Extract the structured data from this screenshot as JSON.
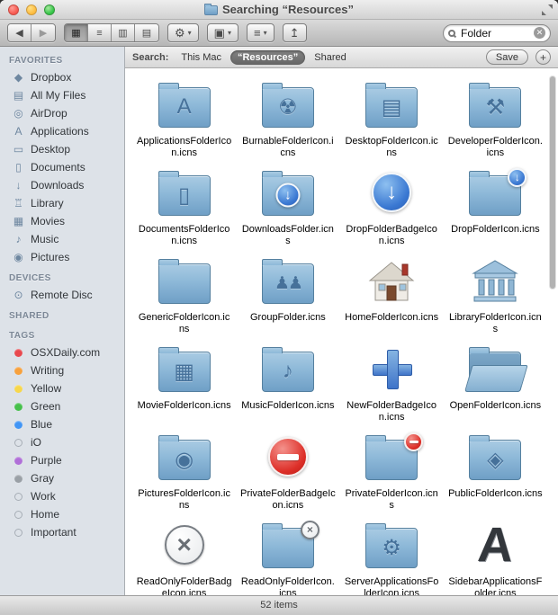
{
  "window": {
    "title": "Searching “Resources”",
    "status": "52 items"
  },
  "toolbar": {
    "back_icon": "◀",
    "forward_icon": "▶",
    "dropdown_arrow": "▾",
    "view_modes": [
      {
        "name": "icon-view",
        "glyph": "▦",
        "selected": true
      },
      {
        "name": "list-view",
        "glyph": "≡",
        "selected": false
      },
      {
        "name": "column-view",
        "glyph": "▥",
        "selected": false
      },
      {
        "name": "coverflow-view",
        "glyph": "▤",
        "selected": false
      }
    ],
    "menus": [
      {
        "name": "action-menu",
        "icon": "gear-icon",
        "glyph": "⚙"
      },
      {
        "name": "arrange-menu",
        "icon": "arrange-icon",
        "glyph": "▣"
      },
      {
        "name": "view-options-menu",
        "icon": "list-lines-icon",
        "glyph": "≡"
      }
    ],
    "share_glyph": "↥",
    "search": {
      "value": "Folder",
      "clear_icon": "✕"
    }
  },
  "scopebar": {
    "label": "Search:",
    "scopes": [
      {
        "label": "This Mac",
        "selected": false
      },
      {
        "label": "“Resources”",
        "selected": true
      },
      {
        "label": "Shared",
        "selected": false
      }
    ],
    "save_label": "Save",
    "add_label": "+"
  },
  "sidebar": {
    "sections": [
      {
        "title": "FAVORITES",
        "kind": "places",
        "items": [
          {
            "label": "Dropbox",
            "icon": "dropbox-icon",
            "glyph": "◆"
          },
          {
            "label": "All My Files",
            "icon": "all-my-files-icon",
            "glyph": "▤"
          },
          {
            "label": "AirDrop",
            "icon": "airdrop-icon",
            "glyph": "◎"
          },
          {
            "label": "Applications",
            "icon": "applications-icon",
            "glyph": "A"
          },
          {
            "label": "Desktop",
            "icon": "desktop-icon",
            "glyph": "▭"
          },
          {
            "label": "Documents",
            "icon": "documents-icon",
            "glyph": "▯"
          },
          {
            "label": "Downloads",
            "icon": "downloads-icon",
            "glyph": "↓"
          },
          {
            "label": "Library",
            "icon": "library-icon",
            "glyph": "♖"
          },
          {
            "label": "Movies",
            "icon": "movies-icon",
            "glyph": "▦"
          },
          {
            "label": "Music",
            "icon": "music-icon",
            "glyph": "♪"
          },
          {
            "label": "Pictures",
            "icon": "pictures-icon",
            "glyph": "◉"
          }
        ]
      },
      {
        "title": "DEVICES",
        "kind": "places",
        "items": [
          {
            "label": "Remote Disc",
            "icon": "remote-disc-icon",
            "glyph": "⊙"
          }
        ]
      },
      {
        "title": "SHARED",
        "kind": "places",
        "items": []
      },
      {
        "title": "TAGS",
        "kind": "tags",
        "items": [
          {
            "label": "OSXDaily.com",
            "color": "#e8484d"
          },
          {
            "label": "Writing",
            "color": "#f7a13d"
          },
          {
            "label": "Yellow",
            "color": "#f7d74c"
          },
          {
            "label": "Green",
            "color": "#46c04b"
          },
          {
            "label": "Blue",
            "color": "#4195f5"
          },
          {
            "label": "iO",
            "color": null
          },
          {
            "label": "Purple",
            "color": "#b06fd8"
          },
          {
            "label": "Gray",
            "color": "#9aa0a6"
          },
          {
            "label": "Work",
            "color": null
          },
          {
            "label": "Home",
            "color": null
          },
          {
            "label": "Important",
            "color": null
          }
        ]
      }
    ]
  },
  "files": [
    {
      "name": "ApplicationsFolderIcon.icns",
      "icon": "applications-folder-icon",
      "kind": "folder",
      "glyph": "A",
      "glyph_pos": "center"
    },
    {
      "name": "BurnableFolderIcon.icns",
      "icon": "burnable-folder-icon",
      "kind": "folder",
      "glyph": "☢",
      "glyph_pos": "center"
    },
    {
      "name": "DesktopFolderIcon.icns",
      "icon": "desktop-folder-icon",
      "kind": "folder",
      "glyph": "▤",
      "glyph_pos": "center"
    },
    {
      "name": "DeveloperFolderIcon.icns",
      "icon": "developer-folder-icon",
      "kind": "folder",
      "glyph": "⚒",
      "glyph_pos": "center"
    },
    {
      "name": "DocumentsFolderIcon.icns",
      "icon": "documents-folder-icon",
      "kind": "folder",
      "glyph": "▯",
      "glyph_pos": "center"
    },
    {
      "name": "DownloadsFolder.icns",
      "icon": "downloads-folder-icon",
      "kind": "folder",
      "glyph": "↓",
      "glyph_pos": "center-circle"
    },
    {
      "name": "DropFolderBadgeIcon.icns",
      "icon": "drop-folder-badge-icon",
      "kind": "badge-circle-blue",
      "glyph": "↓"
    },
    {
      "name": "DropFolderIcon.icns",
      "icon": "drop-folder-icon",
      "kind": "folder",
      "glyph": "↓",
      "glyph_pos": "corner-blue"
    },
    {
      "name": "GenericFolderIcon.icns",
      "icon": "generic-folder-icon",
      "kind": "folder",
      "glyph": "",
      "glyph_pos": ""
    },
    {
      "name": "GroupFolder.icns",
      "icon": "group-folder-icon",
      "kind": "folder",
      "glyph": "♟♟",
      "glyph_pos": "center"
    },
    {
      "name": "HomeFolderIcon.icns",
      "icon": "home-folder-icon",
      "kind": "house"
    },
    {
      "name": "LibraryFolderIcon.icns",
      "icon": "library-folder-icon",
      "kind": "building"
    },
    {
      "name": "MovieFolderIcon.icns",
      "icon": "movie-folder-icon",
      "kind": "folder",
      "glyph": "▦",
      "glyph_pos": "center"
    },
    {
      "name": "MusicFolderIcon.icns",
      "icon": "music-folder-icon",
      "kind": "folder",
      "glyph": "♪",
      "glyph_pos": "center"
    },
    {
      "name": "NewFolderBadgeIcon.icns",
      "icon": "new-folder-badge-icon",
      "kind": "badge-plus"
    },
    {
      "name": "OpenFolderIcon.icns",
      "icon": "open-folder-icon",
      "kind": "folder-open",
      "glyph": "",
      "glyph_pos": ""
    },
    {
      "name": "PicturesFolderIcon.icns",
      "icon": "pictures-folder-icon",
      "kind": "folder",
      "glyph": "◉",
      "glyph_pos": "center"
    },
    {
      "name": "PrivateFolderBadgeIcon.icns",
      "icon": "private-folder-badge-icon",
      "kind": "badge-circle-red"
    },
    {
      "name": "PrivateFolderIcon.icns",
      "icon": "private-folder-icon",
      "kind": "folder",
      "glyph": "",
      "glyph_pos": "corner-red"
    },
    {
      "name": "PublicFolderIcon.icns",
      "icon": "public-folder-icon",
      "kind": "folder",
      "glyph": "◈",
      "glyph_pos": "center"
    },
    {
      "name": "ReadOnlyFolderBadgeIcon.icns",
      "icon": "read-only-folder-badge-icon",
      "kind": "badge-circle-gray"
    },
    {
      "name": "ReadOnlyFolderIcon.icns",
      "icon": "read-only-folder-icon",
      "kind": "folder",
      "glyph": "",
      "glyph_pos": "corner-gray"
    },
    {
      "name": "ServerApplicationsFolderIcon.icns",
      "icon": "server-applications-folder-icon",
      "kind": "folder",
      "glyph": "⚙",
      "glyph_pos": "center"
    },
    {
      "name": "SidebarApplicationsFolder.icns",
      "icon": "sidebar-applications-folder-icon",
      "kind": "stencil-a",
      "glyph": "A"
    }
  ]
}
